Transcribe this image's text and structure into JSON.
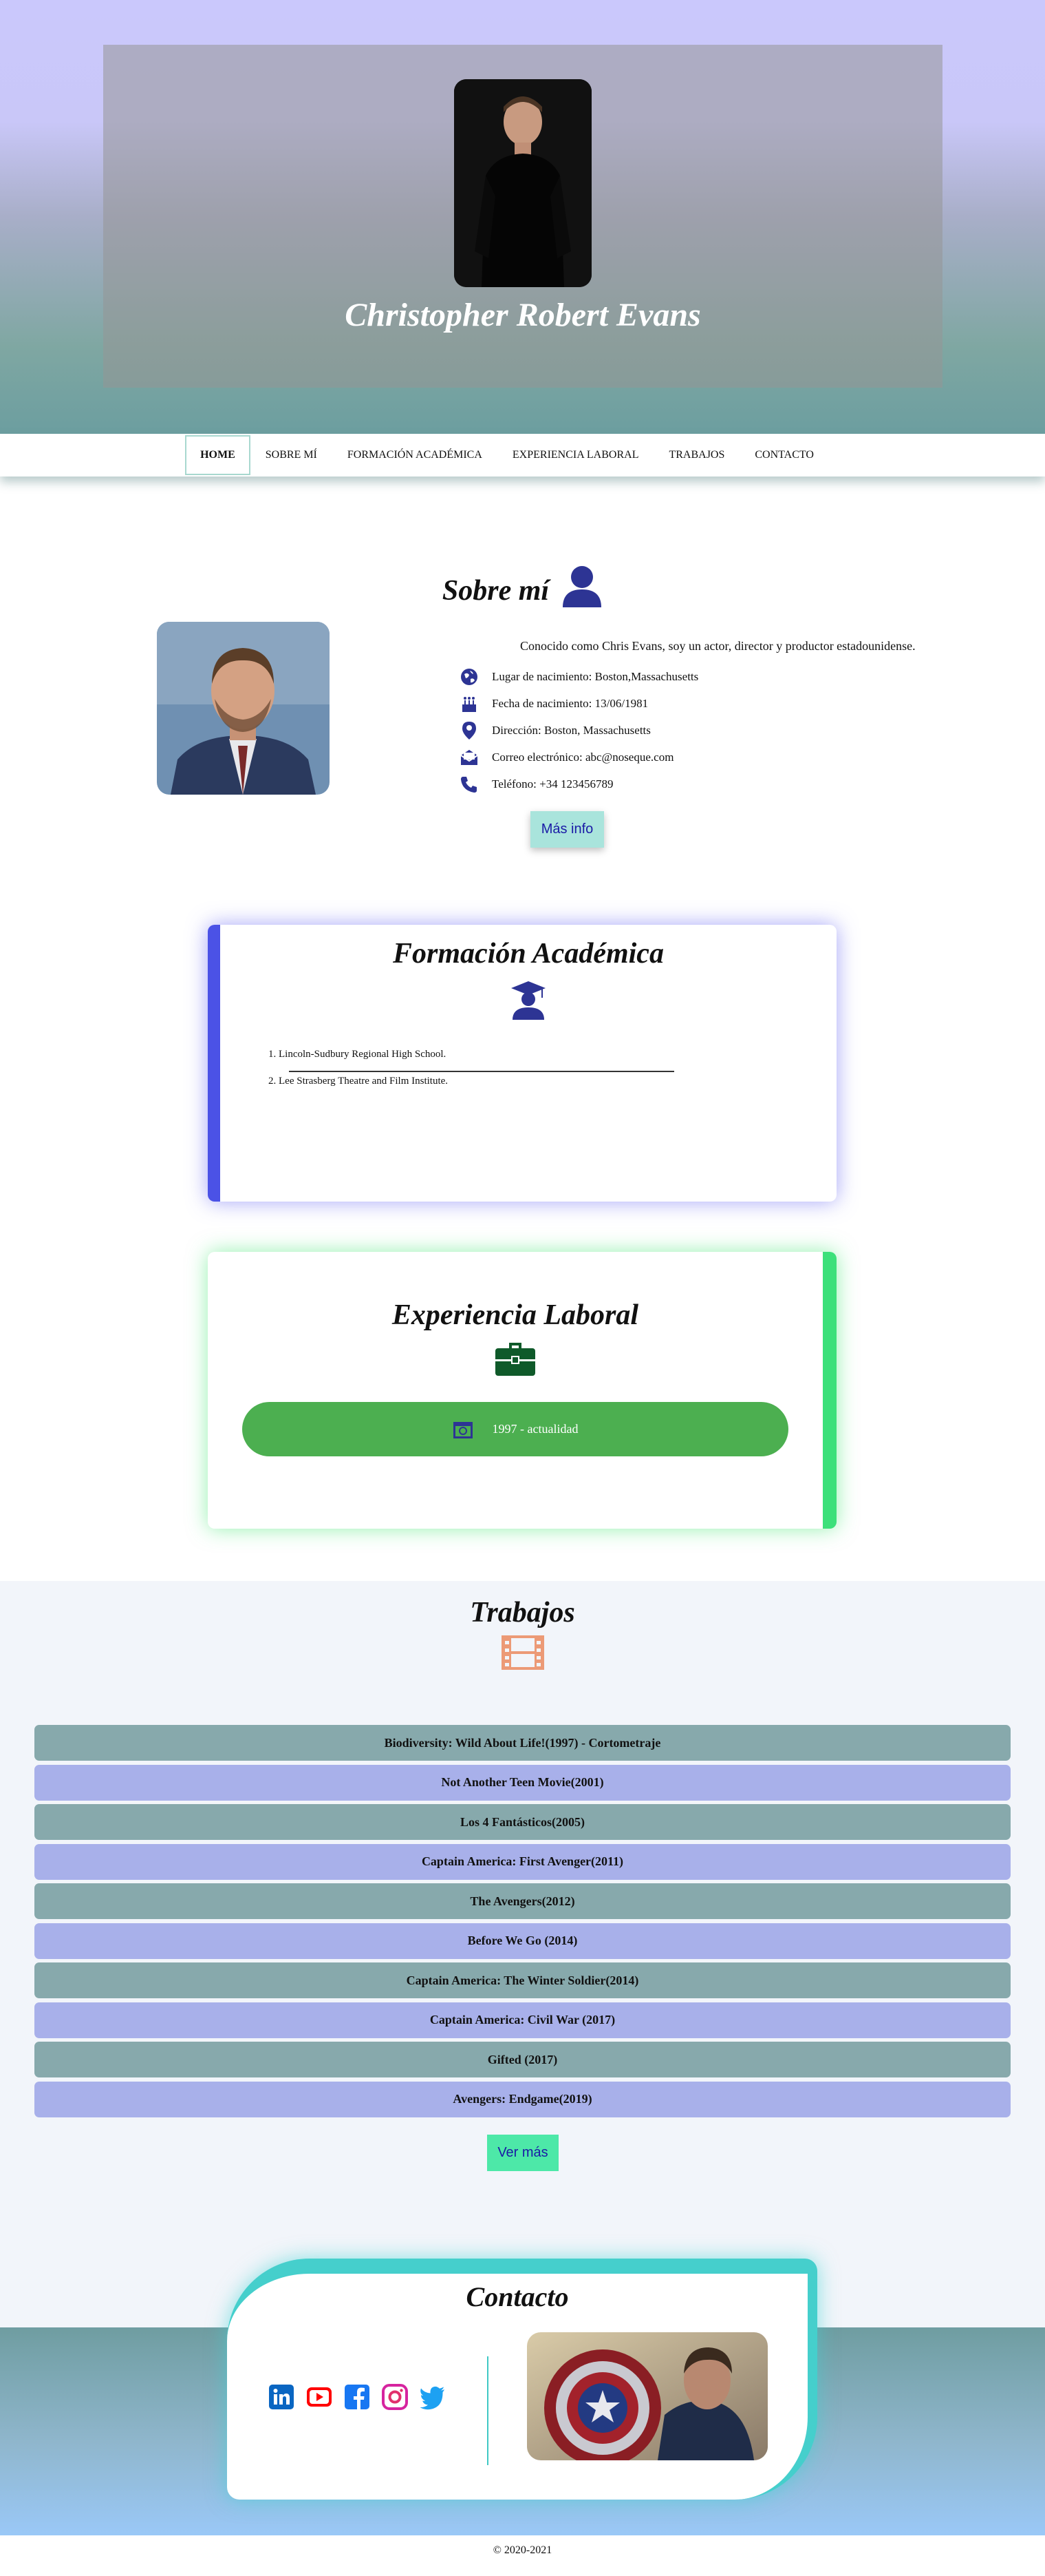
{
  "hero": {
    "name": "Christopher Robert Evans"
  },
  "nav": {
    "items": [
      {
        "label": "HOME",
        "active": true
      },
      {
        "label": "SOBRE MÍ"
      },
      {
        "label": "FORMACIÓN ACADÉMICA"
      },
      {
        "label": "EXPERIENCIA LABORAL"
      },
      {
        "label": "TRABAJOS"
      },
      {
        "label": "CONTACTO"
      }
    ]
  },
  "sobre": {
    "title": "Sobre mí",
    "intro": "Conocido como Chris Evans, soy un actor, director y productor estadounidense.",
    "info": [
      {
        "icon": "globe-icon",
        "text": "Lugar de nacimiento: Boston,Massachusetts"
      },
      {
        "icon": "cake-icon",
        "text": "Fecha de nacimiento: 13/06/1981"
      },
      {
        "icon": "map-pin-icon",
        "text": "Dirección: Boston, Massachusetts"
      },
      {
        "icon": "mail-icon",
        "text": "Correo electrónico: abc@noseque.com"
      },
      {
        "icon": "phone-icon",
        "text": "Teléfono: +34 123456789"
      }
    ],
    "button": "Más info"
  },
  "formacion": {
    "title": "Formación Académica",
    "items": [
      "1. Lincoln-Sudbury Regional High School.",
      "2. Lee Strasberg Theatre and Film Institute."
    ],
    "accent": "#4b52e6"
  },
  "experiencia": {
    "title": "Experiencia Laboral",
    "period": "1997 - actualidad",
    "accent": "#3ce07a",
    "bar_color": "#4caf50"
  },
  "trabajos": {
    "title": "Trabajos",
    "items": [
      "Biodiversity: Wild About Life!(1997) - Cortometraje",
      "Not Another Teen Movie(2001)",
      "Los 4 Fantásticos(2005)",
      "Captain America: First Avenger(2011)",
      "The Avengers(2012)",
      "Before We Go (2014)",
      "Captain America: The Winter Soldier(2014)",
      "Captain America: Civil War (2017)",
      "Gifted (2017)",
      "Avengers: Endgame(2019)"
    ],
    "button": "Ver más"
  },
  "contacto": {
    "title": "Contacto",
    "social": [
      "linkedin-icon",
      "youtube-icon",
      "facebook-icon",
      "instagram-icon",
      "twitter-icon"
    ]
  },
  "footer": {
    "text": "© 2020-2021"
  }
}
